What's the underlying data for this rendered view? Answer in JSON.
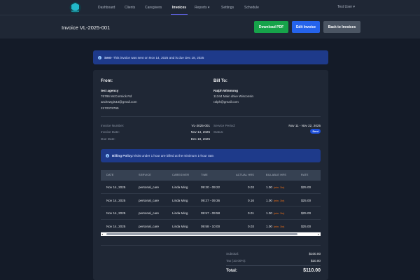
{
  "nav": {
    "items": [
      "Dashboard",
      "Clients",
      "Caregivers",
      "Invoices",
      "Reports",
      "Settings",
      "Schedule"
    ],
    "active": "Invoices",
    "user": "Test User"
  },
  "header": {
    "title": "Invoice VL-2025-001",
    "download": "Download PDF",
    "edit": "Edit Invoice",
    "back": "Back to Invoices"
  },
  "alert": {
    "strong": "Sent",
    "text": " - This invoice was sent on Nov 14, 2025 and is due Dec 18, 2025"
  },
  "from": {
    "heading": "From:",
    "name": "test agency",
    "address": "76786 McCormick Rd",
    "email": "andrewgis43@gmail.com",
    "phone": "2172078765"
  },
  "bill_to": {
    "heading": "Bill To:",
    "name": "Ralph Winmong",
    "address": "11344 Main drive Wisconsin",
    "email": "ralph@gmail.com"
  },
  "meta": {
    "invoice_number_label": "Invoice Number:",
    "invoice_number": "VL-2025-001",
    "invoice_date_label": "Invoice Date:",
    "invoice_date": "Nov 14, 2025",
    "due_date_label": "Due Date:",
    "due_date": "Dec 18, 2025",
    "service_period_label": "Service Period:",
    "service_period": "Nov 11 - Nov 22, 2025",
    "status_label": "Status:",
    "status": "Sent"
  },
  "policy": {
    "strong": "Billing Policy:",
    "text": " Visits under 1 hour are billed at the minimum 1-hour rate."
  },
  "table": {
    "headers": [
      "DATE",
      "SERVICE",
      "CAREGIVER",
      "TIME",
      "ACTUAL HRS",
      "BILLABLE HRS",
      "RATE"
    ],
    "min_note": "(min. 1hr)",
    "rows": [
      [
        "Nov 14, 2025",
        "personal_care",
        "Linda Ming",
        "09:20 - 09:22",
        "0.03",
        "1.00",
        "$25.00"
      ],
      [
        "Nov 14, 2025",
        "personal_care",
        "Linda Ming",
        "09:27 - 09:36",
        "0.16",
        "1.00",
        "$25.00"
      ],
      [
        "Nov 14, 2025",
        "personal_care",
        "Linda Ming",
        "09:57 - 09:58",
        "0.01",
        "1.00",
        "$25.00"
      ],
      [
        "Nov 14, 2025",
        "personal_care",
        "Linda Ming",
        "09:58 - 10:00",
        "0.03",
        "1.00",
        "$25.00"
      ]
    ]
  },
  "totals": {
    "subtotal_label": "Subtotal:",
    "subtotal": "$100.00",
    "tax_label": "Tax (10.00%):",
    "tax": "$10.00",
    "total_label": "Total:",
    "total": "$110.00"
  }
}
